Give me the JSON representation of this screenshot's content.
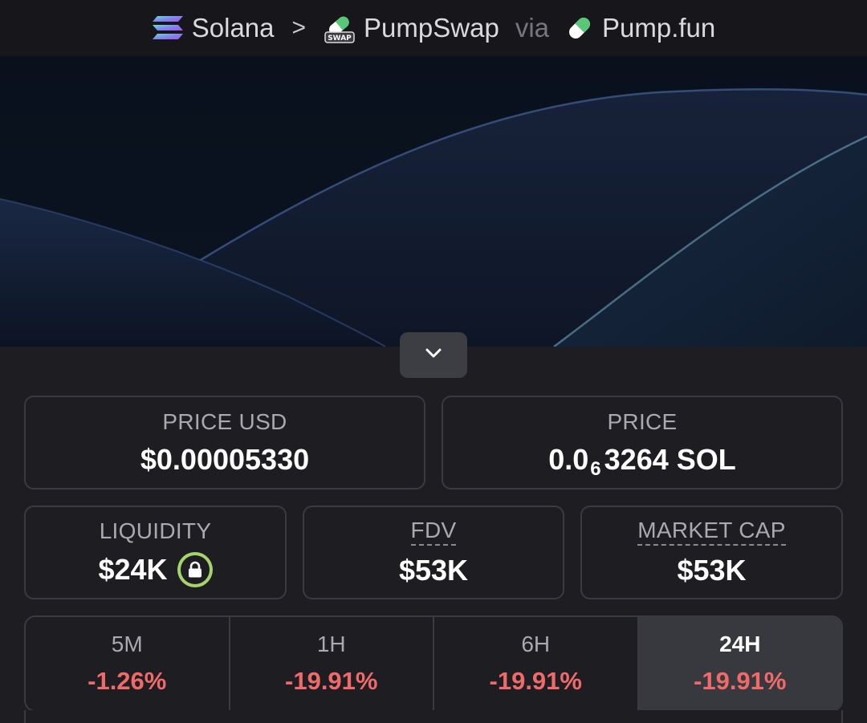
{
  "breadcrumb": {
    "chain": "Solana",
    "separator": ">",
    "dex": "PumpSwap",
    "dex_badge": "SWAP",
    "via": "via",
    "launchpad": "Pump.fun"
  },
  "stats": {
    "price_usd": {
      "label": "PRICE USD",
      "value": "$0.00005330"
    },
    "price_native": {
      "label": "PRICE",
      "prefix": "0.0",
      "zeros": "6",
      "suffix": "3264 SOL"
    },
    "liquidity": {
      "label": "LIQUIDITY",
      "value": "$24K"
    },
    "fdv": {
      "label": "FDV",
      "value": "$53K"
    },
    "market_cap": {
      "label": "MARKET CAP",
      "value": "$53K"
    }
  },
  "timeframes": [
    {
      "label": "5M",
      "change": "-1.26%"
    },
    {
      "label": "1H",
      "change": "-19.91%"
    },
    {
      "label": "6H",
      "change": "-19.91%"
    },
    {
      "label": "24H",
      "change": "-19.91%",
      "active": true
    }
  ],
  "icons": {
    "chain": "solana-icon",
    "dex": "pumpswap-icon",
    "launchpad": "pill-icon",
    "collapse": "chevron-down-icon",
    "liquidity_lock": "lock-icon"
  },
  "colors": {
    "negative": "#f06a6a",
    "lock_badge": "#a6d36a",
    "background": "#1d1d22"
  }
}
